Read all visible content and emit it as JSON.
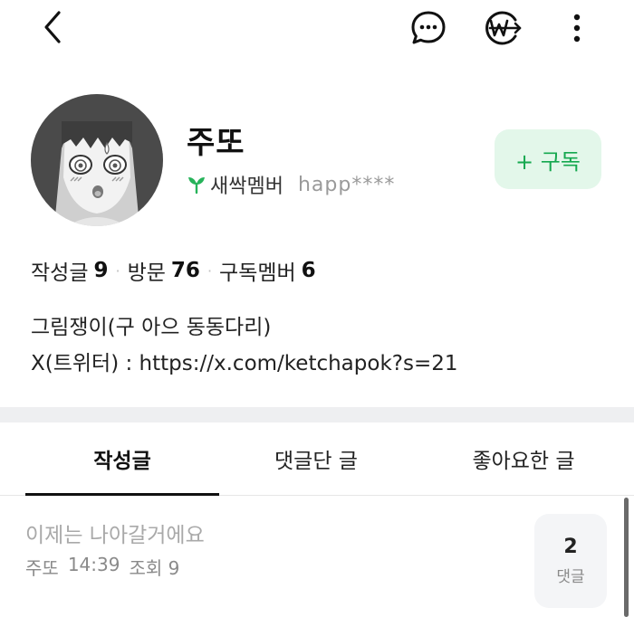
{
  "profile": {
    "nickname": "주또",
    "grade": "새싹멤버",
    "user_id": "happ****",
    "subscribe_label": "+ 구독"
  },
  "stats": {
    "posts_label": "작성글",
    "posts_value": "9",
    "visits_label": "방문",
    "visits_value": "76",
    "subscribers_label": "구독멤버",
    "subscribers_value": "6"
  },
  "intro": {
    "line1": "그림쟁이(구 아으 동동다리)",
    "line2": "X(트위터) : https://x.com/ketchapok?s=21"
  },
  "tabs": [
    {
      "label": "작성글",
      "active": true
    },
    {
      "label": "댓글단 글",
      "active": false
    },
    {
      "label": "좋아요한 글",
      "active": false
    }
  ],
  "post": {
    "title": "이제는 나아갈거에요",
    "author": "주또",
    "time": "14:39",
    "views": "조회 9",
    "comment_count": "2",
    "comment_label": "댓글"
  },
  "icons": {
    "back": "chevron-left-icon",
    "chat": "chat-bubble-icon",
    "wonpay": "won-arrow-icon",
    "more": "more-vertical-icon",
    "sprout": "sprout-icon"
  },
  "colors": {
    "accent_green": "#15a84f",
    "subscribe_bg": "#e3f7ea"
  }
}
